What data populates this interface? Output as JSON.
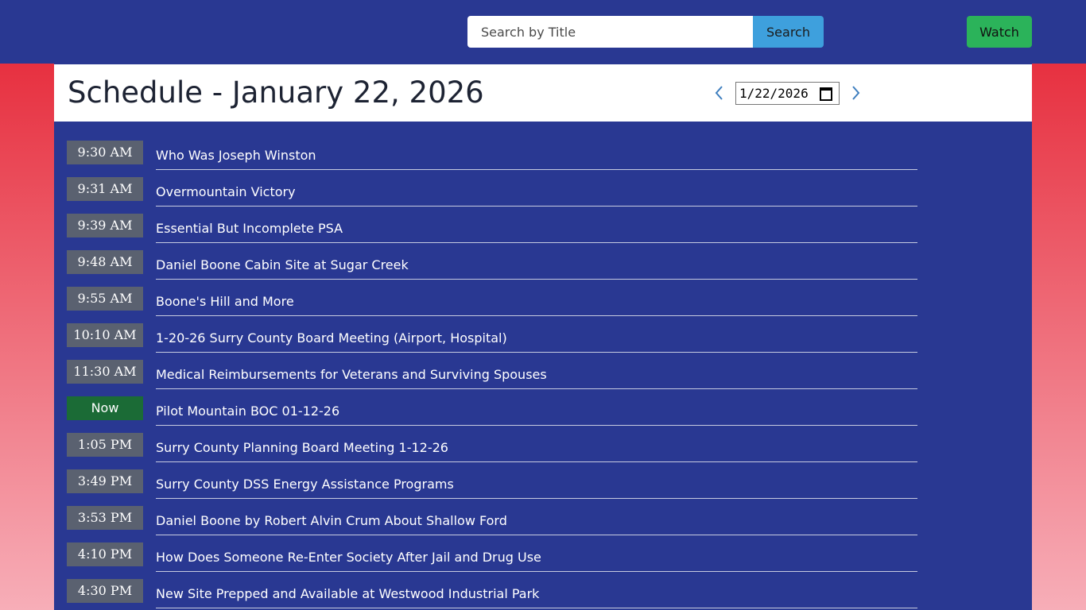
{
  "header": {
    "search_placeholder": "Search by Title",
    "search_label": "Search",
    "watch_label": "Watch"
  },
  "schedule": {
    "title": "Schedule - January 22, 2026",
    "date_value": "1/22/2026",
    "items": [
      {
        "time": "9:30 AM",
        "title": "Who Was Joseph Winston",
        "is_now": false
      },
      {
        "time": "9:31 AM",
        "title": "Overmountain Victory",
        "is_now": false
      },
      {
        "time": "9:39 AM",
        "title": "Essential But Incomplete PSA",
        "is_now": false
      },
      {
        "time": "9:48 AM",
        "title": "Daniel Boone Cabin Site at Sugar Creek",
        "is_now": false
      },
      {
        "time": "9:55 AM",
        "title": "Boone's Hill and More",
        "is_now": false
      },
      {
        "time": "10:10 AM",
        "title": "1-20-26 Surry County Board Meeting (Airport, Hospital)",
        "is_now": false
      },
      {
        "time": "11:30 AM",
        "title": "Medical Reimbursements for Veterans and Surviving Spouses",
        "is_now": false
      },
      {
        "time": "Now",
        "title": "Pilot Mountain BOC 01-12-26",
        "is_now": true
      },
      {
        "time": "1:05 PM",
        "title": "Surry County Planning Board Meeting 1-12-26",
        "is_now": false
      },
      {
        "time": "3:49 PM",
        "title": "Surry County DSS Energy Assistance Programs",
        "is_now": false
      },
      {
        "time": "3:53 PM",
        "title": "Daniel Boone by Robert Alvin Crum About Shallow Ford",
        "is_now": false
      },
      {
        "time": "4:10 PM",
        "title": "How Does Someone Re-Enter Society After Jail and Drug Use",
        "is_now": false
      },
      {
        "time": "4:30 PM",
        "title": "New Site Prepped and Available at Westwood Industrial Park",
        "is_now": false
      }
    ]
  },
  "colors": {
    "header_bg": "#293892",
    "search_button": "#3ea0dd",
    "watch_button": "#2bb35a",
    "time_badge": "#5a6170",
    "now_badge": "#1b6b36",
    "page_gradient_top": "#e52232",
    "page_gradient_bottom": "#f7aeb8"
  },
  "icons": {
    "prev": "chevron-left-icon",
    "next": "chevron-right-icon",
    "calendar": "calendar-icon"
  }
}
